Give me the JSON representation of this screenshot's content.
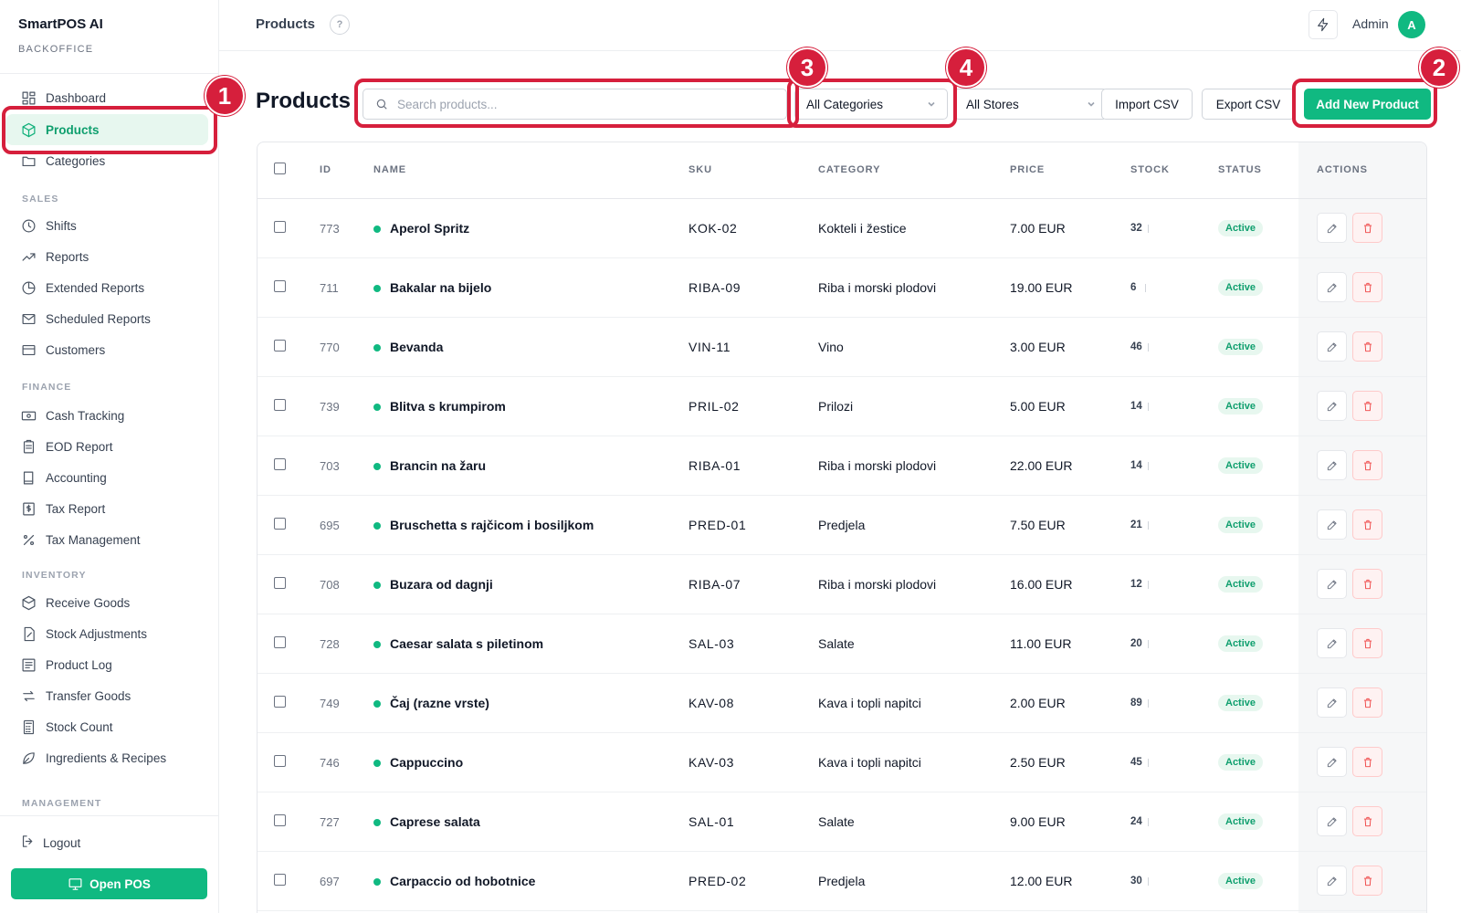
{
  "brand": {
    "title": "SmartPOS AI",
    "subtitle": "BACKOFFICE"
  },
  "topbar": {
    "title": "Products",
    "help_icon": "?",
    "user_name": "Admin",
    "avatar_initial": "A"
  },
  "sidebar": {
    "items_top": [
      {
        "label": "Dashboard",
        "icon": "dashboard-icon"
      },
      {
        "label": "Products",
        "icon": "box-icon",
        "active": true
      },
      {
        "label": "Categories",
        "icon": "folder-icon"
      }
    ],
    "sections": {
      "sales": "SALES",
      "finance": "FINANCE",
      "inventory": "INVENTORY",
      "management": "MANAGEMENT"
    },
    "sales_items": [
      "Shifts",
      "Reports",
      "Extended Reports",
      "Scheduled Reports",
      "Customers"
    ],
    "finance_items": [
      "Cash Tracking",
      "EOD Report",
      "Accounting",
      "Tax Report",
      "Tax Management"
    ],
    "inventory_items": [
      "Receive Goods",
      "Stock Adjustments",
      "Product Log",
      "Transfer Goods",
      "Stock Count",
      "Ingredients & Recipes"
    ],
    "logout": "Logout",
    "open_pos": "Open POS"
  },
  "toolbar": {
    "page_title": "Products",
    "search_placeholder": "Search products...",
    "category_select": "All Categories",
    "store_select": "All Stores",
    "import_label": "Import CSV",
    "export_label": "Export CSV",
    "add_label": "Add New Product"
  },
  "annotations": [
    "1",
    "2",
    "3",
    "4"
  ],
  "table": {
    "columns": [
      "ID",
      "NAME",
      "SKU",
      "CATEGORY",
      "PRICE",
      "STOCK",
      "STATUS",
      "ACTIONS"
    ],
    "rows": [
      {
        "id": "773",
        "name": "Aperol Spritz",
        "sku": "KOK-02",
        "category": "Kokteli i žestice",
        "price": "7.00 EUR",
        "stock": "32",
        "status": "Active"
      },
      {
        "id": "711",
        "name": "Bakalar na bijelo",
        "sku": "RIBA-09",
        "category": "Riba i morski plodovi",
        "price": "19.00 EUR",
        "stock": "6",
        "status": "Active"
      },
      {
        "id": "770",
        "name": "Bevanda",
        "sku": "VIN-11",
        "category": "Vino",
        "price": "3.00 EUR",
        "stock": "46",
        "status": "Active"
      },
      {
        "id": "739",
        "name": "Blitva s krumpirom",
        "sku": "PRIL-02",
        "category": "Prilozi",
        "price": "5.00 EUR",
        "stock": "14",
        "status": "Active"
      },
      {
        "id": "703",
        "name": "Brancin na žaru",
        "sku": "RIBA-01",
        "category": "Riba i morski plodovi",
        "price": "22.00 EUR",
        "stock": "14",
        "status": "Active"
      },
      {
        "id": "695",
        "name": "Bruschetta s rajčicom i bosiljkom",
        "sku": "PRED-01",
        "category": "Predjela",
        "price": "7.50 EUR",
        "stock": "21",
        "status": "Active"
      },
      {
        "id": "708",
        "name": "Buzara od dagnji",
        "sku": "RIBA-07",
        "category": "Riba i morski plodovi",
        "price": "16.00 EUR",
        "stock": "12",
        "status": "Active"
      },
      {
        "id": "728",
        "name": "Caesar salata s piletinom",
        "sku": "SAL-03",
        "category": "Salate",
        "price": "11.00 EUR",
        "stock": "20",
        "status": "Active"
      },
      {
        "id": "749",
        "name": "Čaj (razne vrste)",
        "sku": "KAV-08",
        "category": "Kava i topli napitci",
        "price": "2.00 EUR",
        "stock": "89",
        "status": "Active"
      },
      {
        "id": "746",
        "name": "Cappuccino",
        "sku": "KAV-03",
        "category": "Kava i topli napitci",
        "price": "2.50 EUR",
        "stock": "45",
        "status": "Active"
      },
      {
        "id": "727",
        "name": "Caprese salata",
        "sku": "SAL-01",
        "category": "Salate",
        "price": "9.00 EUR",
        "stock": "24",
        "status": "Active"
      },
      {
        "id": "697",
        "name": "Carpaccio od hobotnice",
        "sku": "PRED-02",
        "category": "Predjela",
        "price": "12.00 EUR",
        "stock": "30",
        "status": "Active"
      }
    ]
  },
  "colors": {
    "accent": "#10b981",
    "annotation": "#d61f3c",
    "active_bg": "#e7f7ef"
  }
}
